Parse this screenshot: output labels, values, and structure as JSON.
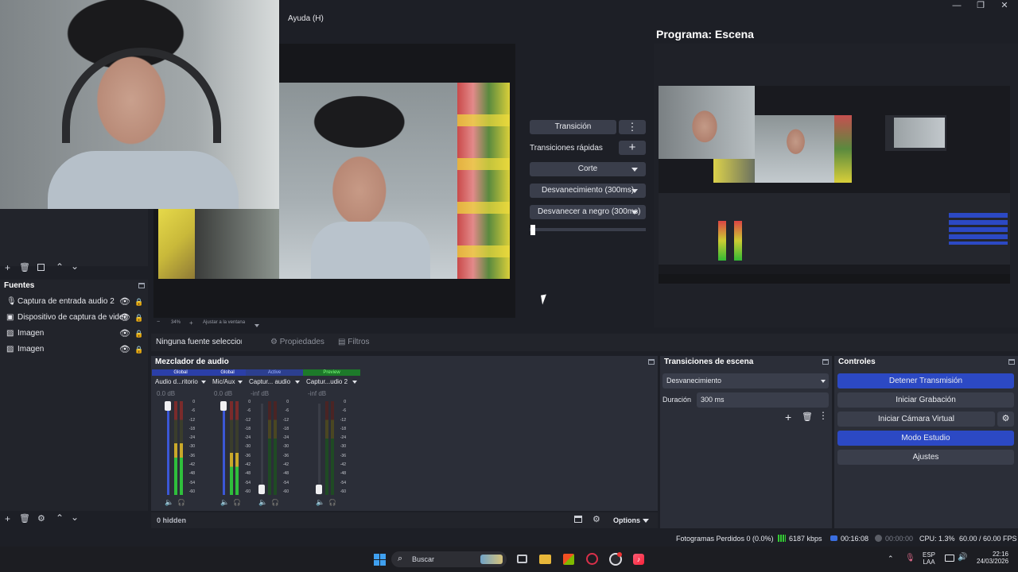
{
  "window": {
    "minimize": "—",
    "maximize": "❐",
    "close": "✕"
  },
  "menu": {
    "help": "Ayuda (H)"
  },
  "program": {
    "title": "Programa: Escena"
  },
  "transitions_mid": {
    "transition_btn": "Transición",
    "quick_label": "Transiciones rápidas",
    "items": [
      "Corte",
      "Desvanecimiento (300ms)",
      "Desvanecer a negro (300ms)"
    ]
  },
  "preview_bar": {
    "zoom": "34%",
    "fit": "Ajustar a la ventana"
  },
  "source_toolbar": {
    "no_source": "Ninguna fuente seleccionad",
    "properties": "Propiedades",
    "filters": "Filtros"
  },
  "sources": {
    "title": "Fuentes",
    "items": [
      {
        "label": "Captura de entrada audio 2",
        "icon": "microphone-icon"
      },
      {
        "label": "Dispositivo de captura de video",
        "icon": "camera-icon"
      },
      {
        "label": "Imagen",
        "icon": "image-icon"
      },
      {
        "label": "Imagen",
        "icon": "image-icon"
      }
    ]
  },
  "mixer": {
    "title": "Mezclador de audio",
    "channels": [
      {
        "badge": "Global",
        "badge_color": "#2b3fa8",
        "name": "Audio d...ritorio",
        "db": "0.0 dB",
        "level": 0.55
      },
      {
        "badge": "Global",
        "badge_color": "#2b3fa8",
        "name": "Mic/Aux",
        "db": "0.0 dB",
        "level": 0.45
      },
      {
        "badge": "Active",
        "badge_color": "#2c3f8f",
        "name": "Captur... audio",
        "db": "-inf dB",
        "level": 0.0
      },
      {
        "badge": "Preview",
        "badge_color": "#1d7a2a",
        "name": "Captur...udio 2",
        "db": "-inf dB",
        "level": 0.0
      }
    ],
    "scale": [
      "0",
      "-6",
      "-12",
      "-18",
      "-24",
      "-30",
      "-36",
      "-42",
      "-48",
      "-54",
      "-60"
    ],
    "hidden": "0 hidden",
    "options": "Options"
  },
  "scene_transitions": {
    "title": "Transiciones de escena",
    "selected": "Desvanecimiento",
    "duration_label": "Duración",
    "duration_value": "300 ms"
  },
  "controls": {
    "title": "Controles",
    "buttons": [
      "Detener Transmisión",
      "Iniciar Grabación",
      "Iniciar Cámara Virtual",
      "Modo Estudio",
      "Ajustes"
    ]
  },
  "status": {
    "dropped": "Fotogramas Perdidos 0 (0.0%)",
    "kbps": "6187 kbps",
    "stream_time": "00:16:08",
    "rec_time": "00:00:00",
    "cpu": "CPU: 1.3%",
    "fps": "60.00 / 60.00 FPS"
  },
  "taskbar": {
    "search": "Buscar",
    "lang1": "ESP",
    "lang2": "LAA",
    "time": "22:16",
    "date": "24/03/2026"
  },
  "colors": {
    "accent_blue": "#2c49c4",
    "panel": "#2b2e38",
    "bg": "#1d1f26"
  }
}
